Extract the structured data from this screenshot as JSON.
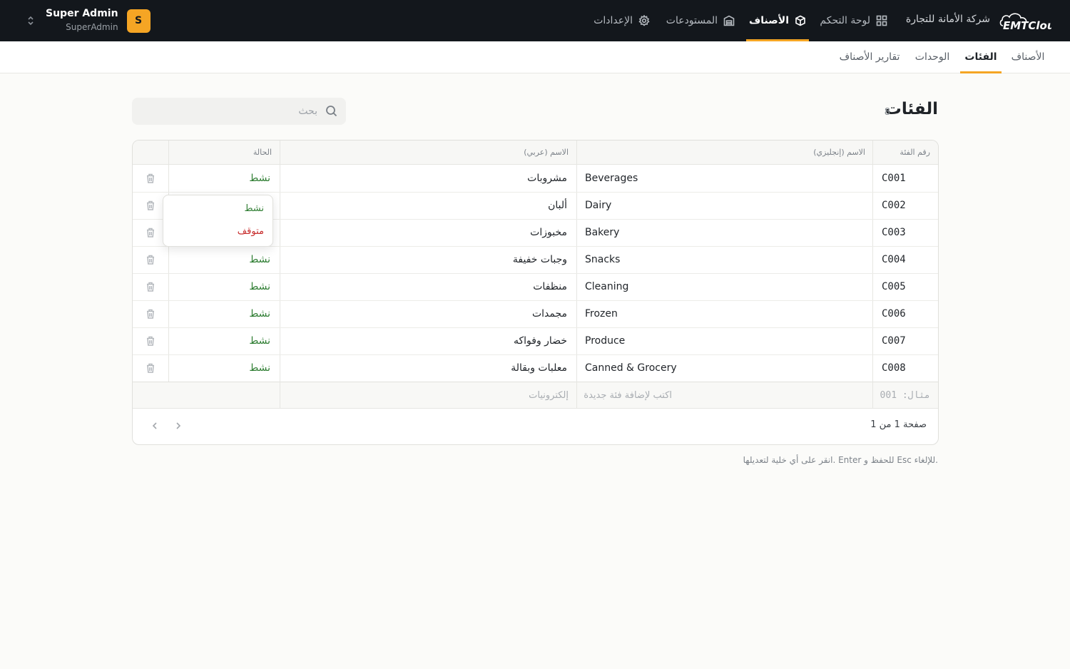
{
  "header": {
    "logo_text": "EMTCloud",
    "company": "شركة الأمانة للتجارة",
    "nav": [
      {
        "label": "لوحة التحكم",
        "icon": "grid-icon"
      },
      {
        "label": "الأصناف",
        "icon": "box-icon",
        "active": true
      },
      {
        "label": "المستودعات",
        "icon": "warehouse-icon"
      },
      {
        "label": "الإعدادات",
        "icon": "gear-icon"
      }
    ],
    "user": {
      "name": "Super Admin",
      "role": "SuperAdmin",
      "initial": "S"
    }
  },
  "subtabs": [
    "الأصناف",
    "الفئات",
    "الوحدات",
    "تقارير الأصناف"
  ],
  "page": {
    "title": "الفئات",
    "count": "8"
  },
  "search": {
    "placeholder": "بحث"
  },
  "table": {
    "headers": {
      "code": "رقم الفئة",
      "name_en": "الاسم (إنجليزي)",
      "name_ar": "الاسم (عربي)",
      "status": "الحالة"
    },
    "rows": [
      {
        "code": "C001",
        "name_en": "Beverages",
        "name_ar": "مشروبات",
        "status": "نشط"
      },
      {
        "code": "C002",
        "name_en": "Dairy",
        "name_ar": "ألبان",
        "status": "نشط"
      },
      {
        "code": "C003",
        "name_en": "Bakery",
        "name_ar": "مخبوزات",
        "status": "نشط"
      },
      {
        "code": "C004",
        "name_en": "Snacks",
        "name_ar": "وجبات خفيفة",
        "status": "نشط"
      },
      {
        "code": "C005",
        "name_en": "Cleaning",
        "name_ar": "منظفات",
        "status": "نشط"
      },
      {
        "code": "C006",
        "name_en": "Frozen",
        "name_ar": "مجمدات",
        "status": "نشط"
      },
      {
        "code": "C007",
        "name_en": "Produce",
        "name_ar": "خضار وفواكه",
        "status": "نشط"
      },
      {
        "code": "C008",
        "name_en": "Canned & Grocery",
        "name_ar": "معلبات وبقالة",
        "status": "نشط"
      }
    ],
    "new_row": {
      "code_placeholder": "مثال: 001",
      "name_en_placeholder": "اكتب لإضافة فئة جديدة",
      "name_ar_placeholder": "إلكترونيات"
    },
    "pagination": "صفحة 1 من 1"
  },
  "status_dropdown": {
    "options": [
      "نشط",
      "متوقف"
    ],
    "colors": {
      "active": "#2e7d32",
      "stopped": "#c62828"
    }
  },
  "hint": "انقر على أي خلية لتعديلها. Enter للحفظ و Esc للإلغاء.",
  "colors": {
    "accent": "#f5a524",
    "topbar": "#13171c"
  }
}
